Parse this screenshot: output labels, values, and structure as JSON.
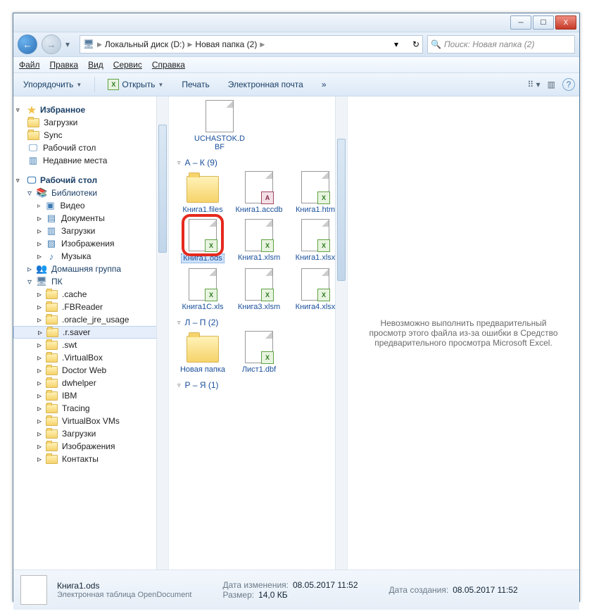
{
  "titlebar": {
    "close": "X"
  },
  "breadcrumb": {
    "pc_icon": "🖥",
    "segments": [
      "Локальный диск (D:)",
      "Новая папка (2)"
    ],
    "refresh": "↻"
  },
  "search": {
    "placeholder": "Поиск: Нoвая nanка (2)"
  },
  "menubar": [
    "Файл",
    "Правка",
    "Вид",
    "Сервис",
    "Справка"
  ],
  "cmdbar": {
    "organize": "Упорядочить",
    "open": "Открыть",
    "print": "Печать",
    "email": "Электронная почта",
    "more": "»"
  },
  "nav": {
    "favorites": {
      "label": "Избранное",
      "items": [
        "Загрузки",
        "Sync",
        "Рабочий стол",
        "Недавние места"
      ]
    },
    "desktop": {
      "label": "Рабочий стол",
      "libraries": {
        "label": "Библиотеки",
        "items": [
          "Видео",
          "Документы",
          "Загрузки",
          "Изображения",
          "Музыка"
        ]
      },
      "homegroup": "Домашняя группа",
      "pc": {
        "label": "ПК",
        "items": [
          ".cache",
          ".FBReader",
          ".oracle_jre_usage",
          ".r.saver",
          ".swt",
          ".VirtualBox",
          "Doctor Web",
          "dwhelper",
          "IBM",
          "Tracing",
          "VirtualBox VMs",
          "Загрузки",
          "Изображения",
          "Контакты"
        ]
      }
    }
  },
  "content": {
    "topfile": "UCHASTOK.DBF",
    "groups": [
      {
        "label": "А – К (9)",
        "items": [
          {
            "name": "Книга1.files",
            "type": "folder"
          },
          {
            "name": "Книга1.accdb",
            "type": "access"
          },
          {
            "name": "Книга1.htm",
            "type": "excel"
          },
          {
            "name": "Книга1.ods",
            "type": "ods",
            "selected": true
          },
          {
            "name": "Книга1.xlsm",
            "type": "excel"
          },
          {
            "name": "Книга1.xlsx",
            "type": "excel"
          },
          {
            "name": "Книга1С.xls",
            "type": "excel"
          },
          {
            "name": "Книга3.xlsm",
            "type": "excel"
          },
          {
            "name": "Книга4.xlsx",
            "type": "excel"
          }
        ]
      },
      {
        "label": "Л – П (2)",
        "items": [
          {
            "name": "Новая папка",
            "type": "folder"
          },
          {
            "name": "Лист1.dbf",
            "type": "excel"
          }
        ]
      },
      {
        "label": "Р – Я (1)",
        "items": []
      }
    ]
  },
  "preview": {
    "message": "Невозможно выполнить предварительный просмотр этого файла из-за ошибки в Средство предварительного просмотра Microsoft Excel."
  },
  "statusbar": {
    "filename": "Книга1.ods",
    "filetype": "Электронная таблица OpenDocument",
    "modified_lbl": "Дата изменения:",
    "modified_val": "08.05.2017 11:52",
    "size_lbl": "Размер:",
    "size_val": "14,0 КБ",
    "created_lbl": "Дата создания:",
    "created_val": "08.05.2017 11:52"
  }
}
